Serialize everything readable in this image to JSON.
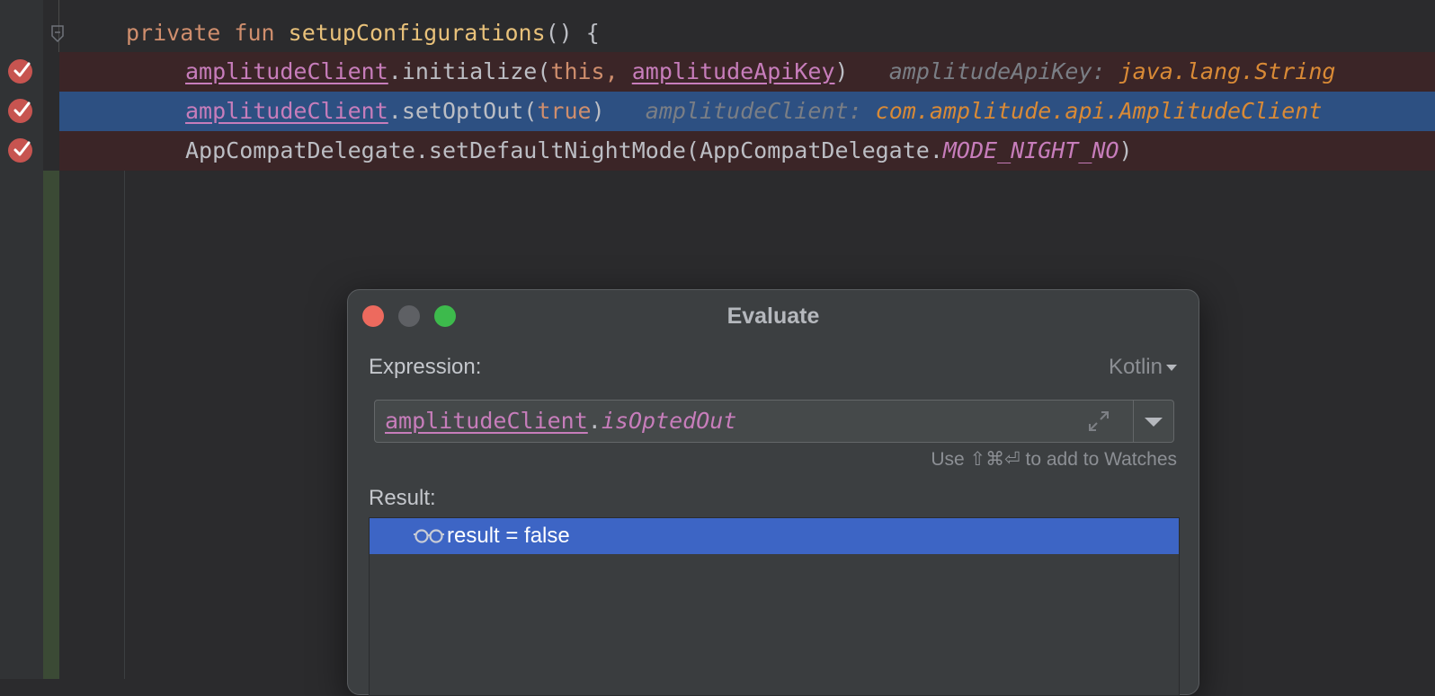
{
  "editor": {
    "lines": [
      {
        "kind": "header",
        "tokens": [
          {
            "t": "private",
            "c": "kw"
          },
          {
            "t": " ",
            "c": "plain"
          },
          {
            "t": "fun",
            "c": "kw"
          },
          {
            "t": " ",
            "c": "plain"
          },
          {
            "t": "setupConfigurations",
            "c": "fn-decl"
          },
          {
            "t": "() {",
            "c": "plain"
          }
        ]
      },
      {
        "kind": "breakpoint",
        "tokens": [
          {
            "t": "amplitudeClient",
            "c": "prop"
          },
          {
            "t": ".initialize(",
            "c": "plain"
          },
          {
            "t": "this",
            "c": "kw"
          },
          {
            "t": ", ",
            "c": "kw"
          },
          {
            "t": "amplitudeApiKey",
            "c": "prop"
          },
          {
            "t": ")",
            "c": "plain"
          },
          {
            "t": "   amplitudeApiKey: ",
            "c": "hint-name"
          },
          {
            "t": "java.lang.String",
            "c": "hint-type"
          }
        ]
      },
      {
        "kind": "current",
        "tokens": [
          {
            "t": "amplitudeClient",
            "c": "prop"
          },
          {
            "t": ".setOptOut(",
            "c": "plain"
          },
          {
            "t": "true",
            "c": "kw"
          },
          {
            "t": ")",
            "c": "plain"
          },
          {
            "t": "   amplitudeClient: ",
            "c": "hint-name"
          },
          {
            "t": "com.amplitude.api.AmplitudeClient",
            "c": "hint-type"
          }
        ]
      },
      {
        "kind": "breakpoint",
        "tokens": [
          {
            "t": "AppCompatDelegate.setDefaultNightMode(AppCompatDelegate.",
            "c": "plain"
          },
          {
            "t": "MODE_NIGHT_NO",
            "c": "const"
          },
          {
            "t": ")",
            "c": "plain"
          }
        ]
      }
    ]
  },
  "dialog": {
    "title": "Evaluate",
    "expression_label": "Expression:",
    "language": "Kotlin",
    "expression": {
      "object": "amplitudeClient",
      "dot": ".",
      "member": "isOptedOut"
    },
    "watch_hint": "Use ⇧⌘⏎ to add to Watches",
    "result_label": "Result:",
    "result": "result = false"
  }
}
